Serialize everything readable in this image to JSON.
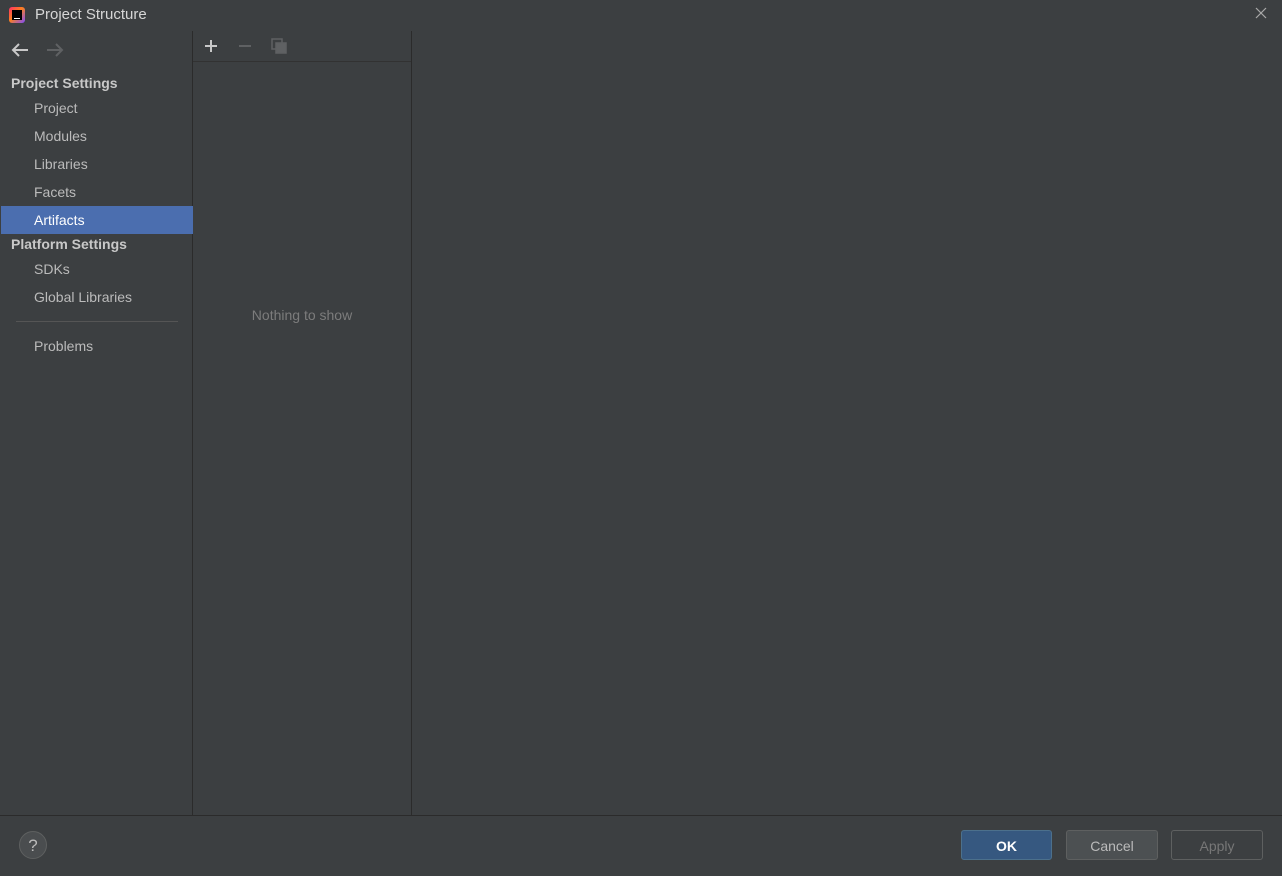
{
  "window": {
    "title": "Project Structure"
  },
  "sidebar": {
    "project_settings_header": "Project Settings",
    "project_items": [
      {
        "label": "Project"
      },
      {
        "label": "Modules"
      },
      {
        "label": "Libraries"
      },
      {
        "label": "Facets"
      },
      {
        "label": "Artifacts",
        "selected": true
      }
    ],
    "platform_settings_header": "Platform Settings",
    "platform_items": [
      {
        "label": "SDKs"
      },
      {
        "label": "Global Libraries"
      }
    ],
    "problems_label": "Problems"
  },
  "list_panel": {
    "toolbar": {
      "add_icon": "plus-icon",
      "remove_icon": "minus-icon",
      "copy_icon": "copy-icon"
    },
    "empty_text": "Nothing to show"
  },
  "footer": {
    "help_label": "?",
    "ok_label": "OK",
    "cancel_label": "Cancel",
    "apply_label": "Apply"
  },
  "colors": {
    "background": "#3c3f41",
    "selection": "#4b6eaf",
    "ok_button": "#365880"
  }
}
